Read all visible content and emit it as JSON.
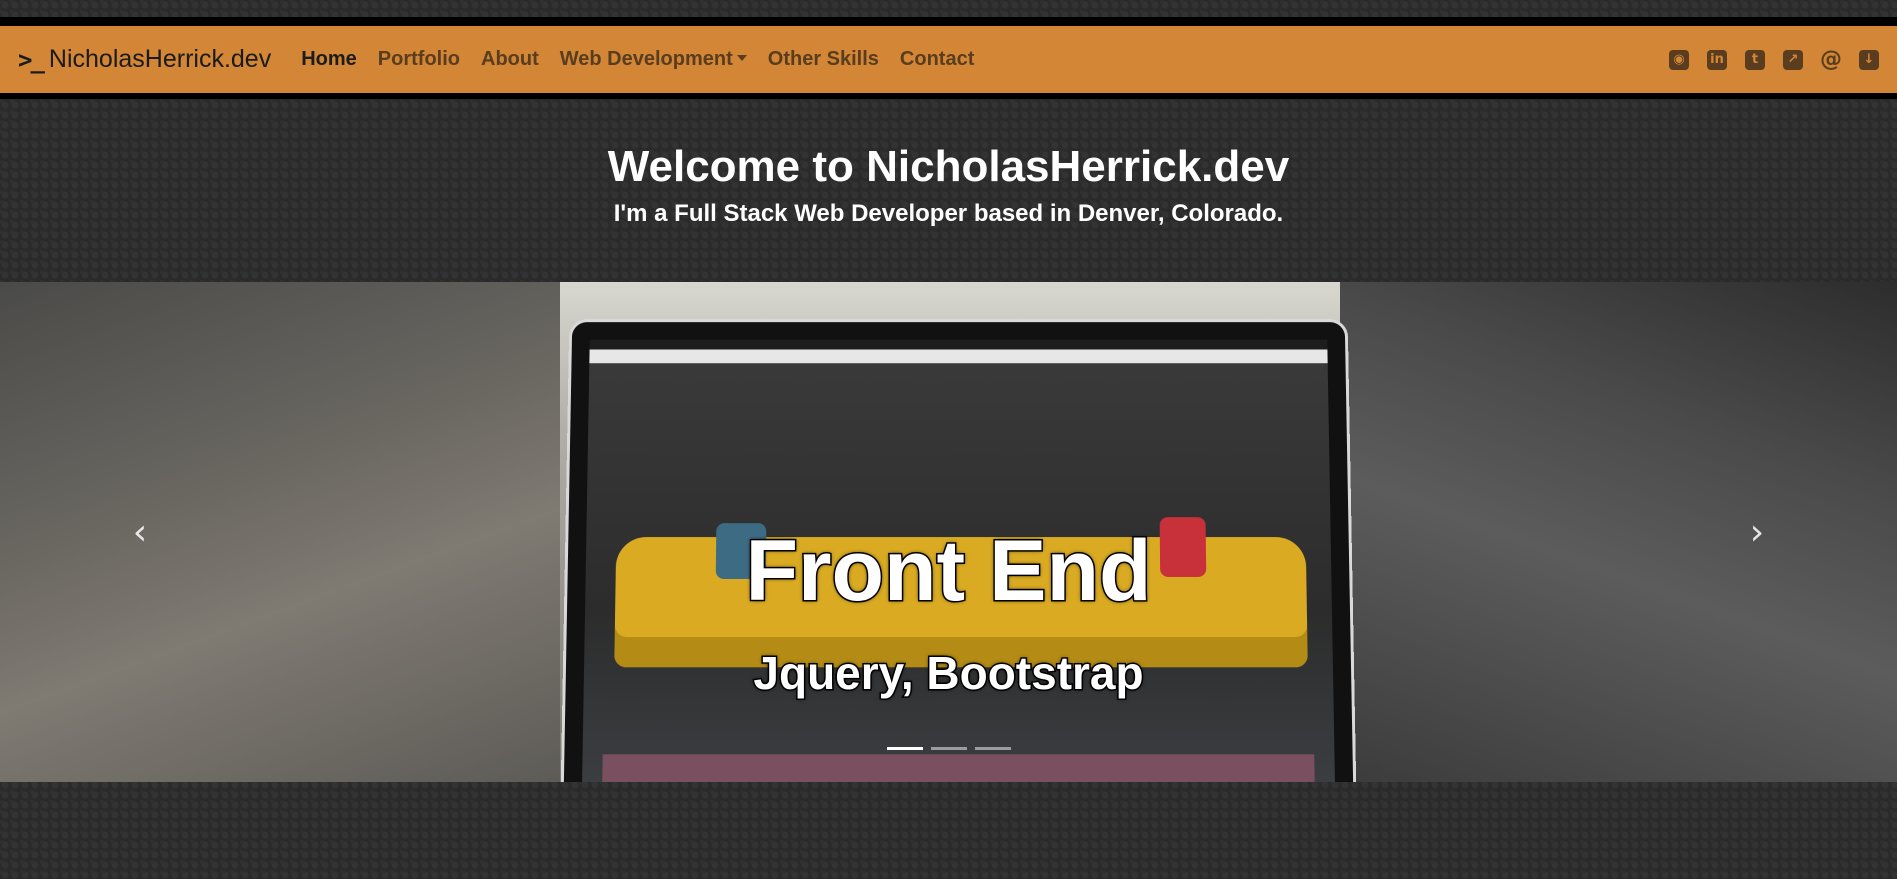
{
  "navbar": {
    "brand_prompt": ">_",
    "brand_name": "NicholasHerrick.dev",
    "links": [
      {
        "label": "Home",
        "active": true
      },
      {
        "label": "Portfolio",
        "active": false
      },
      {
        "label": "About",
        "active": false
      },
      {
        "label": "Web Development",
        "active": false,
        "dropdown": true
      },
      {
        "label": "Other Skills",
        "active": false
      },
      {
        "label": "Contact",
        "active": false
      }
    ],
    "social_icons": [
      {
        "name": "github-icon",
        "glyph": "◉"
      },
      {
        "name": "linkedin-icon",
        "glyph": "in"
      },
      {
        "name": "twitter-icon",
        "glyph": "t"
      },
      {
        "name": "external-link-icon",
        "glyph": "↗"
      },
      {
        "name": "email-icon",
        "glyph": "@"
      },
      {
        "name": "download-icon",
        "glyph": "↓"
      }
    ]
  },
  "hero": {
    "title": "Welcome to NicholasHerrick.dev",
    "subtitle": "I'm a Full Stack Web Developer based in Denver, Colorado."
  },
  "carousel": {
    "slide_title": "Front End",
    "slide_subtitle": "Jquery, Bootstrap",
    "indicators": 3,
    "active_index": 0,
    "prev_glyph": "‹",
    "next_glyph": "›"
  },
  "colors": {
    "navbar_bg": "#d28636",
    "page_bg": "#2a2a2a",
    "nav_text": "#5a3d1f"
  }
}
